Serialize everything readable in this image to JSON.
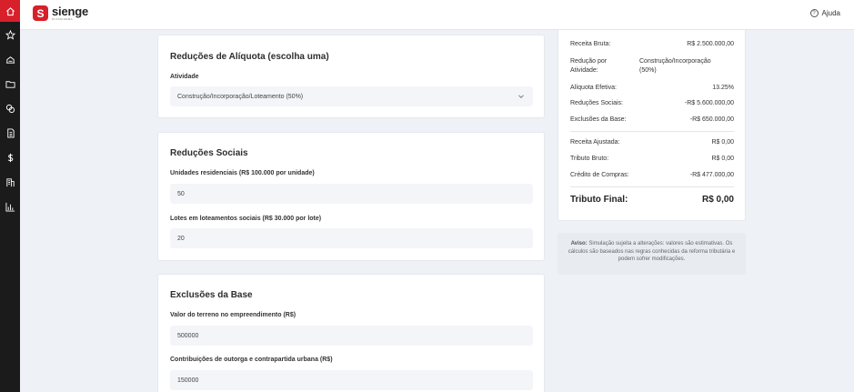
{
  "brand": {
    "name": "sienge",
    "sub": "PLATAFORMA",
    "mark": "S",
    "color": "#d7202a"
  },
  "header": {
    "help_label": "Ajuda",
    "help_icon": "?"
  },
  "nav": {
    "icons": [
      "home-icon",
      "star-icon",
      "building-icon",
      "folder-icon",
      "coins-icon",
      "document-icon",
      "dollar-icon",
      "office-icon",
      "bar-chart-icon"
    ]
  },
  "aliquota": {
    "title": "Reduções de Alíquota (escolha uma)",
    "activity_label": "Atividade",
    "activity_value": "Construção/Incorporação/Loteamento (50%)"
  },
  "sociais": {
    "title": "Reduções Sociais",
    "units_label": "Unidades residenciais (R$ 100.000 por unidade)",
    "units_value": "50",
    "lots_label": "Lotes em loteamentos sociais (R$ 30.000 por lote)",
    "lots_value": "20"
  },
  "exclusoes": {
    "title": "Exclusões da Base",
    "land_label": "Valor do terreno no empreendimento (R$)",
    "land_value": "500000",
    "contrib_label": "Contribuições de outorga e contrapartida urbana (R$)",
    "contrib_value": "150000"
  },
  "summary": {
    "receita_bruta": {
      "label": "Receita Bruta:",
      "value": "R$ 2.500.000,00"
    },
    "reducao_atividade": {
      "label_1": "Redução por",
      "label_2": "Atividade:",
      "value_1": "Construção/Incorporação",
      "value_2": "(50%)"
    },
    "aliquota_efetiva": {
      "label": "Alíquota Efetiva:",
      "value": "13.25%"
    },
    "reducoes_sociais": {
      "label": "Reduções Sociais:",
      "value": "-R$ 5.600.000,00"
    },
    "exclusoes_base": {
      "label": "Exclusões da Base:",
      "value": "-R$ 650.000,00"
    },
    "receita_ajustada": {
      "label": "Receita Ajustada:",
      "value": "R$ 0,00"
    },
    "tributo_bruto": {
      "label": "Tributo Bruto:",
      "value": "R$ 0,00"
    },
    "credito_compras": {
      "label": "Crédito de Compras:",
      "value": "-R$ 477.000,00"
    },
    "tributo_final": {
      "label": "Tributo Final:",
      "value": "R$ 0,00"
    }
  },
  "notice": {
    "bold": "Aviso:",
    "text": "Simulação sujeita a alterações: valores são estimativas. Os cálculos são baseados nas regras conhecidas da reforma tributária e podem sofrer modificações."
  }
}
